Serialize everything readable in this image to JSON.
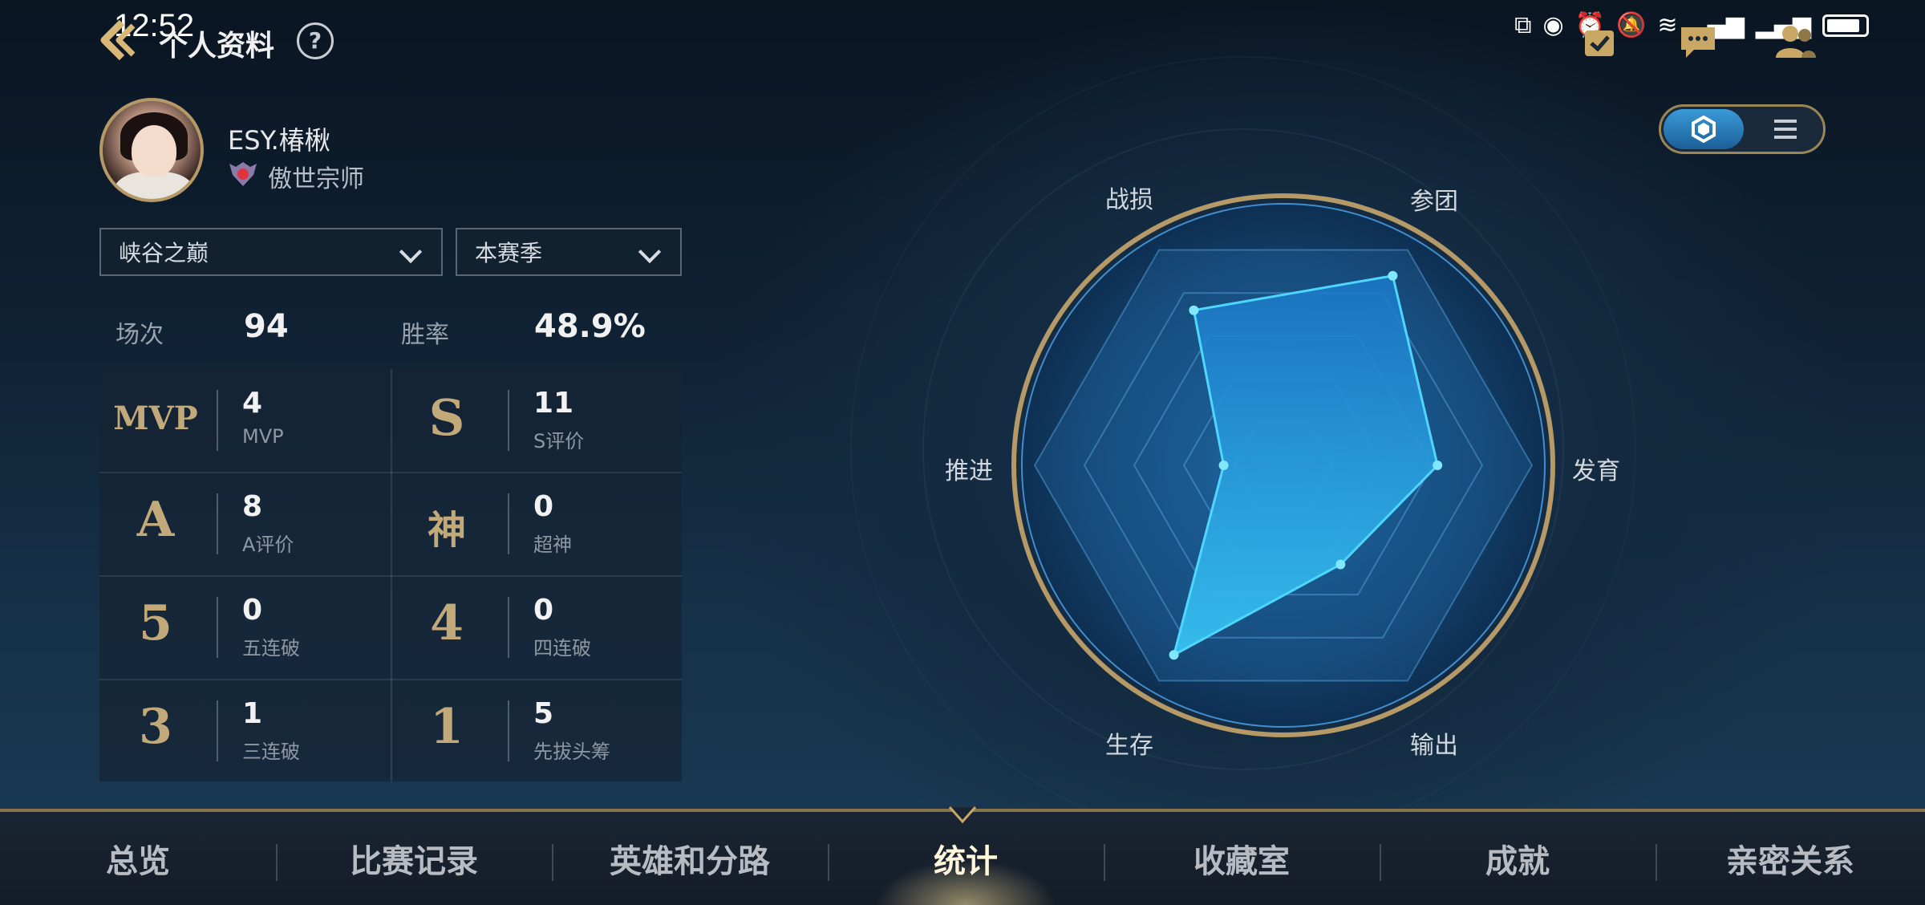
{
  "status_bar": {
    "time": "12:52"
  },
  "header": {
    "title": "个人资料",
    "help": "?"
  },
  "profile": {
    "name": "ESY.椿楸",
    "rank": "傲世宗师"
  },
  "filters": {
    "mode": "峡谷之巅",
    "season": "本赛季"
  },
  "summary": {
    "matches_label": "场次",
    "matches_value": "94",
    "winrate_label": "胜率",
    "winrate_value": "48.9%"
  },
  "stats": [
    {
      "badge": "MVP",
      "value": "4",
      "label": "MVP"
    },
    {
      "badge": "S",
      "value": "11",
      "label": "S评价"
    },
    {
      "badge": "A",
      "value": "8",
      "label": "A评价"
    },
    {
      "badge": "神",
      "value": "0",
      "label": "超神"
    },
    {
      "badge": "5",
      "value": "0",
      "label": "五连破"
    },
    {
      "badge": "4",
      "value": "0",
      "label": "四连破"
    },
    {
      "badge": "3",
      "value": "1",
      "label": "三连破"
    },
    {
      "badge": "1",
      "value": "5",
      "label": "先拔头筹"
    }
  ],
  "radar": {
    "axes": [
      "战损",
      "参团",
      "发育",
      "输出",
      "生存",
      "推进"
    ],
    "values": [
      0.72,
      0.88,
      0.62,
      0.46,
      0.88,
      0.24
    ],
    "fill_color": "#1f8ee0",
    "stroke_color": "#4fd6ff"
  },
  "tabs": [
    {
      "label": "总览",
      "active": false
    },
    {
      "label": "比赛记录",
      "active": false
    },
    {
      "label": "英雄和分路",
      "active": false
    },
    {
      "label": "统计",
      "active": true
    },
    {
      "label": "收藏室",
      "active": false
    },
    {
      "label": "成就",
      "active": false
    },
    {
      "label": "亲密关系",
      "active": false
    }
  ]
}
